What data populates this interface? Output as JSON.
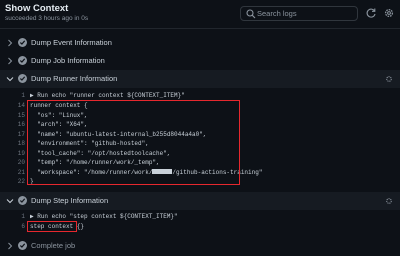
{
  "header": {
    "title": "Show Context",
    "subtitle": "succeeded 3 hours ago in 0s",
    "search_placeholder": "Search logs"
  },
  "steps": [
    {
      "label": "Dump Event Information",
      "expanded": false
    },
    {
      "label": "Dump Job Information",
      "expanded": false
    },
    {
      "label": "Dump Runner Information",
      "expanded": true
    },
    {
      "label": "Dump Step Information",
      "expanded": true
    },
    {
      "label": "Complete job",
      "expanded": false
    }
  ],
  "runner_log": [
    {
      "n": "1",
      "text": "▶ Run echo \"runner context ${CONTEXT_ITEM}\""
    },
    {
      "n": "14",
      "text": "runner context {"
    },
    {
      "n": "15",
      "text": "  \"os\": \"Linux\","
    },
    {
      "n": "16",
      "text": "  \"arch\": \"X64\","
    },
    {
      "n": "17",
      "text": "  \"name\": \"ubuntu-latest-internal_b255d8044a4a0\","
    },
    {
      "n": "18",
      "text": "  \"environment\": \"github-hosted\","
    },
    {
      "n": "19",
      "text": "  \"tool_cache\": \"/opt/hostedtoolcache\","
    },
    {
      "n": "20",
      "text": "  \"temp\": \"/home/runner/work/_temp\","
    },
    {
      "n": "21",
      "text": "  \"workspace\": \"/home/runner/work/"
    },
    {
      "n": "22",
      "text": "}"
    }
  ],
  "workspace_suffix": "/github-actions-training\"",
  "step_log": [
    {
      "n": "1",
      "text": "▶ Run echo \"step context ${CONTEXT_ITEM}\""
    },
    {
      "n": "6",
      "text": "step context {}"
    }
  ],
  "colors": {
    "background": "#0d1117",
    "highlight_box": "#e5282e",
    "success_check": "#8b949e"
  }
}
